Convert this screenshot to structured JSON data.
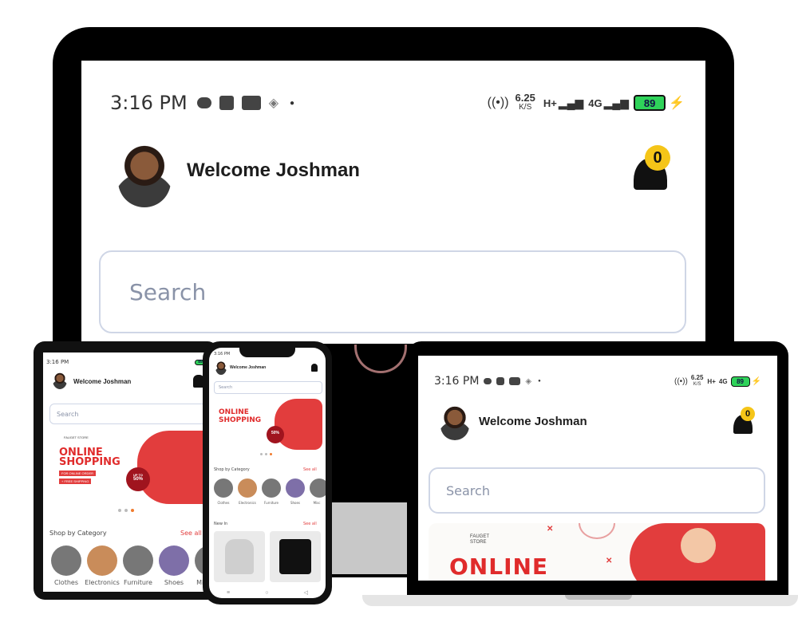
{
  "status_bar": {
    "time": "3:16 PM",
    "speed_value": "6.25",
    "speed_unit": "K/S",
    "network_1": "H+",
    "network_2": "4G",
    "battery": "89"
  },
  "header": {
    "welcome": "Welcome Joshman",
    "notification_count": "0"
  },
  "search": {
    "placeholder": "Search"
  },
  "banner": {
    "store_name": "FAUGET STORE",
    "headline_1": "ONLINE",
    "headline_2": "SHOPPING",
    "tag_1": "FOR ONLINE ORDER",
    "tag_2": "+ FREE SHIPPING",
    "discount_top": "UP TO",
    "discount": "50%"
  },
  "categories": {
    "title": "Shop by Category",
    "see_all": "See all",
    "items": [
      "Clothes",
      "Electronics",
      "Furniture",
      "Shoes",
      "Misc"
    ]
  },
  "new_in": {
    "title": "New In",
    "see_all": "See all"
  },
  "colors": {
    "accent": "#e23d3d",
    "badge": "#f5c518",
    "battery": "#2fd35a"
  }
}
